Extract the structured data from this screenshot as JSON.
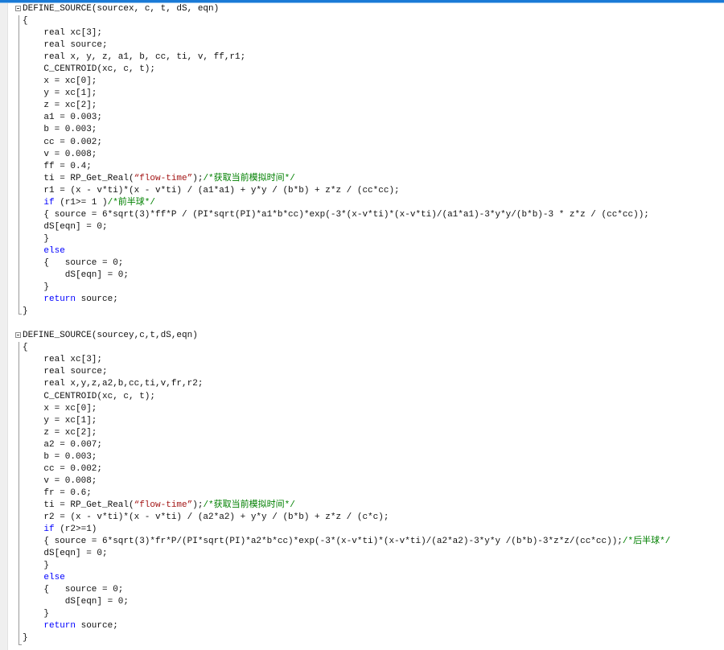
{
  "colors": {
    "keyword": "#0000ff",
    "string": "#a31515",
    "comment": "#008000",
    "accent": "#1a7ad6"
  },
  "lines": [
    {
      "i": 0,
      "fold": true,
      "s": [
        {
          "t": "DEFINE_SOURCE(sourcex, c, t, dS, eqn)"
        }
      ]
    },
    {
      "i": 0,
      "s": [
        {
          "t": "{"
        }
      ]
    },
    {
      "i": 4,
      "s": [
        {
          "t": "real xc[3];"
        }
      ]
    },
    {
      "i": 4,
      "s": [
        {
          "t": "real source;"
        }
      ]
    },
    {
      "i": 4,
      "s": [
        {
          "t": "real x, y, z, a1, b, cc, ti, v, ff,r1;"
        }
      ]
    },
    {
      "i": 4,
      "s": [
        {
          "t": "C_CENTROID(xc, c, t);"
        }
      ]
    },
    {
      "i": 4,
      "s": [
        {
          "t": "x = xc[0];"
        }
      ]
    },
    {
      "i": 4,
      "s": [
        {
          "t": "y = xc[1];"
        }
      ]
    },
    {
      "i": 4,
      "s": [
        {
          "t": "z = xc[2];"
        }
      ]
    },
    {
      "i": 4,
      "s": [
        {
          "t": "a1 = 0.003;"
        }
      ]
    },
    {
      "i": 4,
      "s": [
        {
          "t": "b = 0.003;"
        }
      ]
    },
    {
      "i": 4,
      "s": [
        {
          "t": "cc = 0.002;"
        }
      ]
    },
    {
      "i": 4,
      "s": [
        {
          "t": "v = 0.008;"
        }
      ]
    },
    {
      "i": 4,
      "s": [
        {
          "t": "ff = 0.4;"
        }
      ]
    },
    {
      "i": 4,
      "s": [
        {
          "t": "ti = RP_Get_Real("
        },
        {
          "t": "“flow-time”",
          "c": "str"
        },
        {
          "t": ");"
        },
        {
          "t": "/*获取当前模拟时间*/",
          "c": "cm"
        }
      ]
    },
    {
      "i": 4,
      "s": [
        {
          "t": "r1 = (x - v*ti)*(x - v*ti) / (a1*a1) + y*y / (b*b) + z*z / (cc*cc);"
        }
      ]
    },
    {
      "i": 4,
      "s": [
        {
          "t": "if",
          "c": "kw"
        },
        {
          "t": " (r1>= 1 )"
        },
        {
          "t": "/*前半球*/",
          "c": "cm"
        }
      ]
    },
    {
      "i": 4,
      "s": [
        {
          "t": "{ source = 6*sqrt(3)*ff*P / (PI*sqrt(PI)*a1*b*cc)*exp(-3*(x-v*ti)*(x-v*ti)/(a1*a1)-3*y*y/(b*b)-3 * z*z / (cc*cc));"
        }
      ]
    },
    {
      "i": 4,
      "s": [
        {
          "t": "dS[eqn] = 0;"
        }
      ]
    },
    {
      "i": 4,
      "s": [
        {
          "t": "}"
        }
      ]
    },
    {
      "i": 4,
      "s": [
        {
          "t": "else",
          "c": "kw"
        }
      ]
    },
    {
      "i": 4,
      "s": [
        {
          "t": "{   source = 0;"
        }
      ]
    },
    {
      "i": 8,
      "s": [
        {
          "t": "dS[eqn] = 0;"
        }
      ]
    },
    {
      "i": 4,
      "s": [
        {
          "t": "}"
        }
      ]
    },
    {
      "i": 4,
      "s": [
        {
          "t": "return",
          "c": "kw"
        },
        {
          "t": " source;"
        }
      ]
    },
    {
      "i": 0,
      "s": [
        {
          "t": "}"
        }
      ]
    },
    {
      "i": 0,
      "s": [
        {
          "t": ""
        }
      ]
    },
    {
      "i": 0,
      "fold": true,
      "s": [
        {
          "t": "DEFINE_SOURCE(sourcey,c,t,dS,eqn)"
        }
      ]
    },
    {
      "i": 0,
      "s": [
        {
          "t": "{"
        }
      ]
    },
    {
      "i": 4,
      "s": [
        {
          "t": "real xc[3];"
        }
      ]
    },
    {
      "i": 4,
      "s": [
        {
          "t": "real source;"
        }
      ]
    },
    {
      "i": 4,
      "s": [
        {
          "t": "real x,y,z,a2,b,cc,ti,v,fr,r2;"
        }
      ]
    },
    {
      "i": 4,
      "s": [
        {
          "t": "C_CENTROID(xc, c, t);"
        }
      ]
    },
    {
      "i": 4,
      "s": [
        {
          "t": "x = xc[0];"
        }
      ]
    },
    {
      "i": 4,
      "s": [
        {
          "t": "y = xc[1];"
        }
      ]
    },
    {
      "i": 4,
      "s": [
        {
          "t": "z = xc[2];"
        }
      ]
    },
    {
      "i": 4,
      "s": [
        {
          "t": "a2 = 0.007;"
        }
      ]
    },
    {
      "i": 4,
      "s": [
        {
          "t": "b = 0.003;"
        }
      ]
    },
    {
      "i": 4,
      "s": [
        {
          "t": "cc = 0.002;"
        }
      ]
    },
    {
      "i": 4,
      "s": [
        {
          "t": "v = 0.008;"
        }
      ]
    },
    {
      "i": 4,
      "s": [
        {
          "t": "fr = 0.6;"
        }
      ]
    },
    {
      "i": 4,
      "s": [
        {
          "t": "ti = RP_Get_Real("
        },
        {
          "t": "“flow-time”",
          "c": "str"
        },
        {
          "t": ");"
        },
        {
          "t": "/*获取当前模拟时间*/",
          "c": "cm"
        }
      ]
    },
    {
      "i": 4,
      "s": [
        {
          "t": "r2 = (x - v*ti)*(x - v*ti) / (a2*a2) + y*y / (b*b) + z*z / (c*c);"
        }
      ]
    },
    {
      "i": 4,
      "s": [
        {
          "t": "if",
          "c": "kw"
        },
        {
          "t": " (r2>=1)"
        }
      ]
    },
    {
      "i": 4,
      "s": [
        {
          "t": "{ source = 6*sqrt(3)*fr*P/(PI*sqrt(PI)*a2*b*cc)*exp(-3*(x-v*ti)*(x-v*ti)/(a2*a2)-3*y*y /(b*b)-3*z*z/(cc*cc));"
        },
        {
          "t": "/*后半球*/",
          "c": "cm"
        }
      ]
    },
    {
      "i": 4,
      "s": [
        {
          "t": "dS[eqn] = 0;"
        }
      ]
    },
    {
      "i": 4,
      "s": [
        {
          "t": "}"
        }
      ]
    },
    {
      "i": 4,
      "s": [
        {
          "t": "else",
          "c": "kw"
        }
      ]
    },
    {
      "i": 4,
      "s": [
        {
          "t": "{   source = 0;"
        }
      ]
    },
    {
      "i": 8,
      "s": [
        {
          "t": "dS[eqn] = 0;"
        }
      ]
    },
    {
      "i": 4,
      "s": [
        {
          "t": "}"
        }
      ]
    },
    {
      "i": 4,
      "s": [
        {
          "t": "return",
          "c": "kw"
        },
        {
          "t": " source;"
        }
      ]
    },
    {
      "i": 0,
      "s": [
        {
          "t": "}"
        }
      ]
    }
  ]
}
